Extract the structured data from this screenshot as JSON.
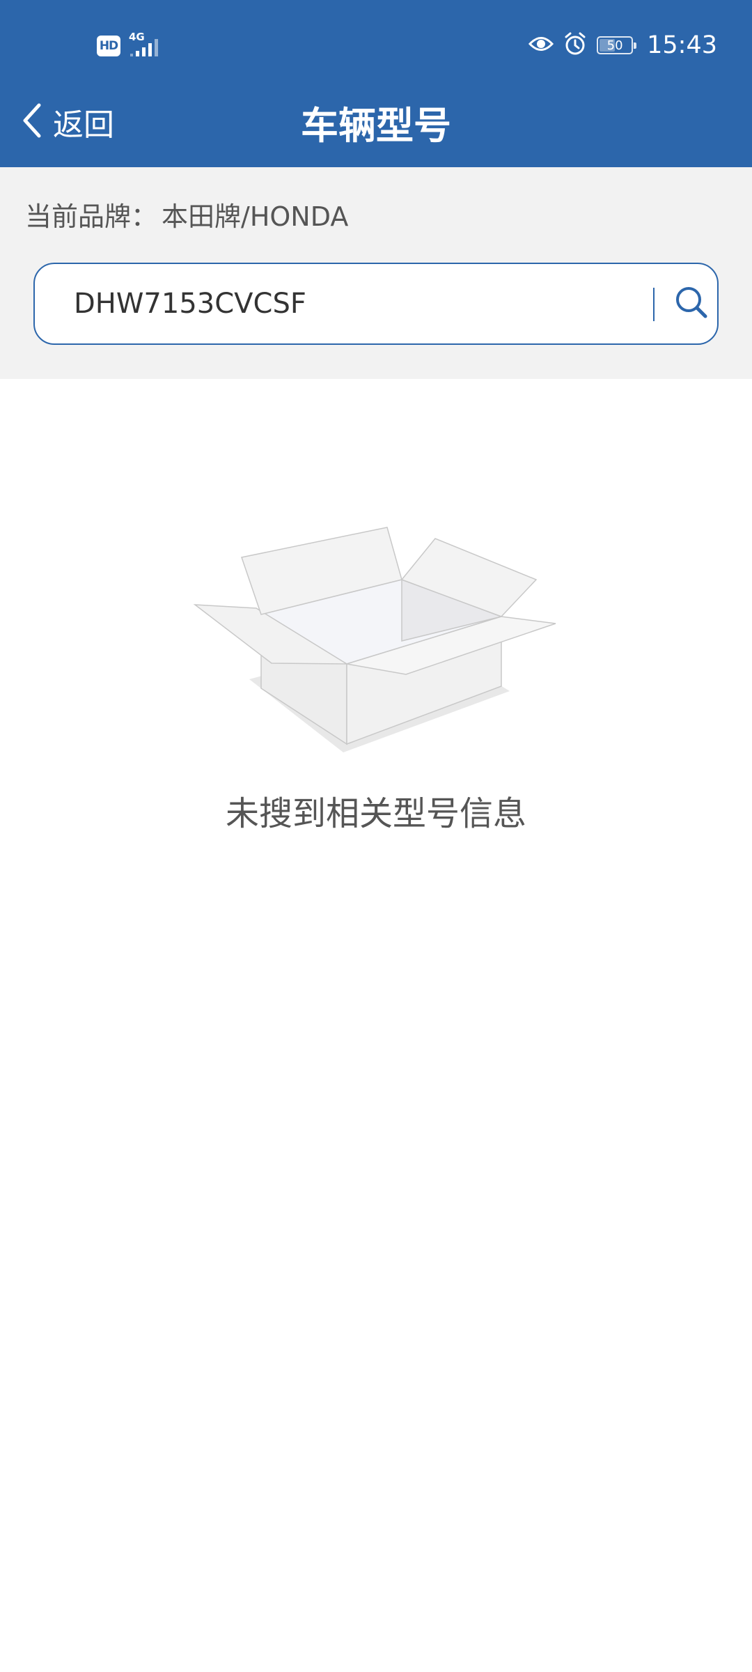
{
  "status_bar": {
    "hd_badge": "HD",
    "network_type": "4G",
    "signal_level": "4/5",
    "icons": [
      "hd-icon",
      "signal-icon",
      "eye-icon",
      "alarm-clock-icon",
      "battery-icon"
    ],
    "battery_level": "50",
    "time": "15:43"
  },
  "nav": {
    "back_label": "返回",
    "title": "车辆型号"
  },
  "brand": {
    "label": "当前品牌：",
    "value": "本田牌/HONDA"
  },
  "search": {
    "value": "DHW7153CVCSF",
    "icon": "search-icon"
  },
  "empty_state": {
    "icon": "empty-box-icon",
    "message": "未搜到相关型号信息"
  },
  "colors": {
    "header_bg": "#2c66ab",
    "section_bg": "#f2f2f2",
    "text_gray": "#555555"
  }
}
